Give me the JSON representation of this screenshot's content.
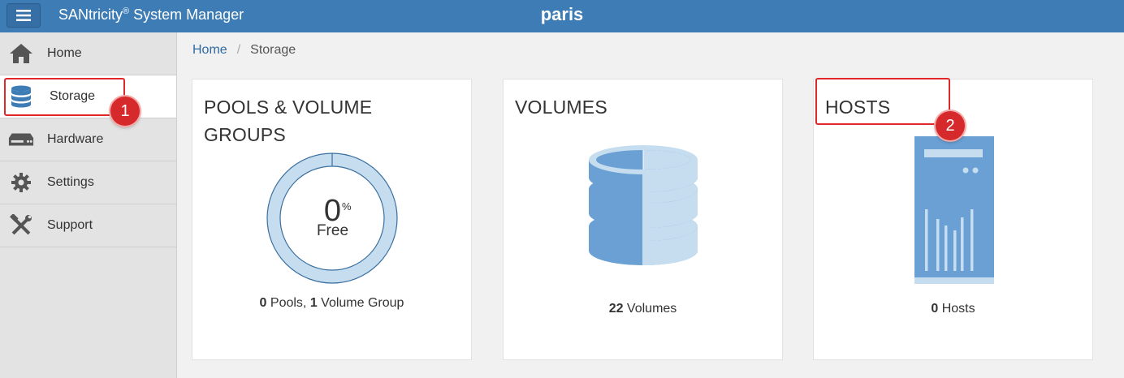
{
  "header": {
    "menu_icon": "hamburger-icon",
    "app_title": "SANtricity",
    "app_title_reg": "®",
    "app_title_rest": " System Manager",
    "system_name": "paris",
    "color": "#3e7cb5"
  },
  "sidebar": {
    "items": [
      {
        "label": "Home",
        "icon": "home-icon"
      },
      {
        "label": "Storage",
        "icon": "database-icon",
        "active": true
      },
      {
        "label": "Hardware",
        "icon": "hardware-icon"
      },
      {
        "label": "Settings",
        "icon": "gear-icon"
      },
      {
        "label": "Support",
        "icon": "tools-icon"
      }
    ]
  },
  "breadcrumb": {
    "home": "Home",
    "separator": "/",
    "current": "Storage"
  },
  "cards": {
    "pools": {
      "title_line1": "POOLS & VOLUME",
      "title_line2": "GROUPS",
      "free_value": "0",
      "free_unit": "%",
      "free_label": "Free",
      "free_fraction": 0.0,
      "pools_count": "0",
      "pools_label": " Pools, ",
      "groups_count": "1",
      "groups_label": " Volume Group"
    },
    "volumes": {
      "title": "VOLUMES",
      "icon": "volumes-database-icon",
      "count": "22",
      "count_label": " Volumes"
    },
    "hosts": {
      "title": "HOSTS",
      "icon": "server-icon",
      "count": "0",
      "count_label": " Hosts"
    }
  },
  "callouts": [
    {
      "number": "1",
      "target": "Storage"
    },
    {
      "number": "2",
      "target": "HOSTS"
    }
  ],
  "colors": {
    "accent_blue": "#6aa0d4",
    "light_blue": "#c5ddef",
    "callout_red": "#d6292c"
  }
}
